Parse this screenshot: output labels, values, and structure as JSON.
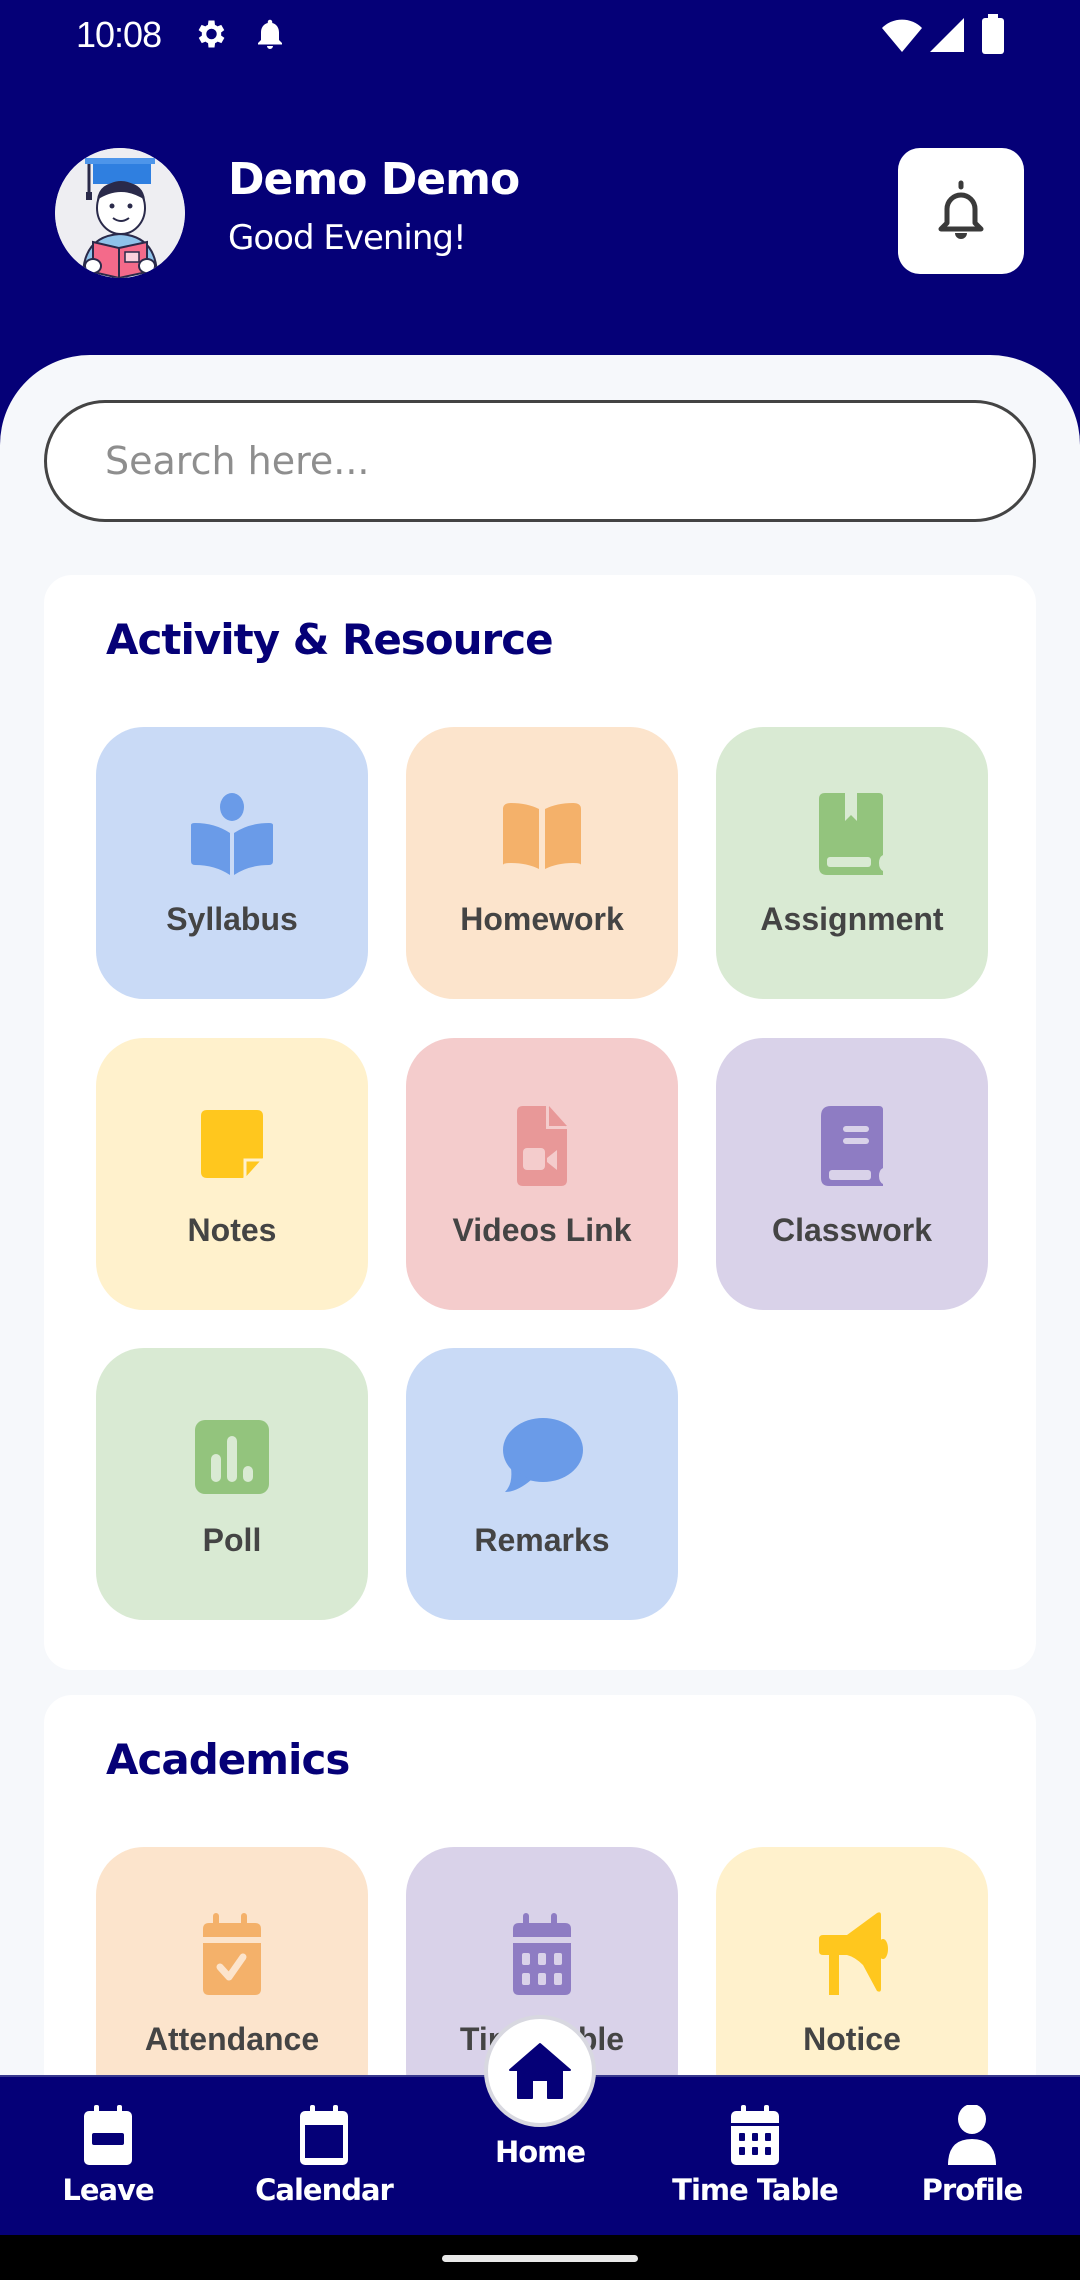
{
  "status_bar": {
    "time": "10:08",
    "left_icons": [
      "settings-icon",
      "notification-bell-icon"
    ],
    "right_icons": [
      "wifi-icon",
      "cellular-signal-icon",
      "battery-icon"
    ]
  },
  "header": {
    "user_name": "Demo Demo",
    "greeting": "Good Evening!",
    "avatar": "student-reading-avatar",
    "notification_button_icon": "bell-icon"
  },
  "search": {
    "placeholder": "Search here...",
    "value": ""
  },
  "sections": [
    {
      "title": "Activity & Resource",
      "tiles": [
        {
          "label": "Syllabus",
          "icon": "reader-book-icon",
          "bg": "#c9daf6",
          "fg": "#6a9be8"
        },
        {
          "label": "Homework",
          "icon": "open-book-icon",
          "bg": "#fce4cc",
          "fg": "#f4b16a"
        },
        {
          "label": "Assignment",
          "icon": "bookmark-book-icon",
          "bg": "#d9ead3",
          "fg": "#93c47d"
        },
        {
          "label": "Notes",
          "icon": "sticky-note-icon",
          "bg": "#fff1cc",
          "fg": "#ffc71e"
        },
        {
          "label": "Videos Link",
          "icon": "video-file-icon",
          "bg": "#f4cccc",
          "fg": "#e89898"
        },
        {
          "label": "Classwork",
          "icon": "book-icon",
          "bg": "#d9d2e9",
          "fg": "#8e7cc3"
        },
        {
          "label": "Poll",
          "icon": "poll-chart-icon",
          "bg": "#d9ead3",
          "fg": "#93c47d"
        },
        {
          "label": "Remarks",
          "icon": "chat-bubble-icon",
          "bg": "#c9daf6",
          "fg": "#6a9be8"
        }
      ]
    },
    {
      "title": "Academics",
      "tiles": [
        {
          "label": "Attendance",
          "icon": "calendar-check-icon",
          "bg": "#fce4cc",
          "fg": "#f4b16a"
        },
        {
          "label": "Time Table",
          "icon": "calendar-grid-icon",
          "bg": "#d9d2e9",
          "fg": "#8e7cc3"
        },
        {
          "label": "Notice",
          "icon": "megaphone-icon",
          "bg": "#fff1cc",
          "fg": "#ffc71e"
        }
      ]
    }
  ],
  "bottom_nav": {
    "items": [
      {
        "label": "Leave",
        "icon": "calendar-minus-icon"
      },
      {
        "label": "Calendar",
        "icon": "calendar-icon"
      },
      {
        "label": "Home",
        "icon": "home-icon",
        "active": true
      },
      {
        "label": "Time Table",
        "icon": "calendar-grid-icon"
      },
      {
        "label": "Profile",
        "icon": "user-icon"
      }
    ]
  },
  "colors": {
    "primary": "#050077",
    "background": "#f6f8fb",
    "tile_text": "#444444"
  }
}
